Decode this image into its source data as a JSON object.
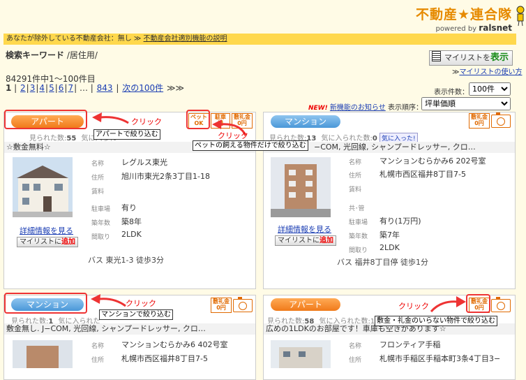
{
  "header": {
    "logo": "不動産★連合隊",
    "powered": "powered by",
    "brand": "ralsnet"
  },
  "exclusion": {
    "text": "あなたが除外している不動産会社：無し ≫",
    "link": "不動産会社適別機能の説明"
  },
  "search": {
    "label": "検索キーワード",
    "value": "/居住用/"
  },
  "mylist": {
    "button_prefix": "マイリストを",
    "button_action": "表示",
    "howto": "マイリストの使い方"
  },
  "results": {
    "count": "84291件中1〜100件目",
    "pages": [
      "2",
      "3",
      "4",
      "5",
      "6",
      "7"
    ],
    "current": "1",
    "ellipsis": "…",
    "last": "843",
    "next": "次の100件",
    "next_arrows": "≫≫"
  },
  "controls": {
    "display_count_label": "表示件数：",
    "display_count": "100件",
    "new_badge": "NEW!",
    "new_link": "新機能のお知らせ",
    "sort_label": "表示順序：",
    "sort_value": "坪単価順"
  },
  "common": {
    "seen_label": "見られた数:",
    "fav_label": "気に入られた数:",
    "fav_button": "気に入った!",
    "detail_link": "詳細情報を見る",
    "add_mylist_prefix": "マイリストに",
    "add_mylist_action": "追加",
    "pet_ok": "ペット\nOK",
    "no_key": "敷礼金\n0円",
    "label_name": "名称",
    "label_address": "住所",
    "label_rent": "賃料",
    "label_parking": "駐車場",
    "label_age": "築年数",
    "label_layout": "間取り",
    "label_fee": "共･管"
  },
  "cards": [
    {
      "type": "アパート",
      "seen": "55",
      "subtitle": "☆敷金無料☆",
      "name": "レグルス東光",
      "address": "旭川市東光2条3丁目1-18",
      "parking": "有り",
      "age": "築8年",
      "layout": "2LDK",
      "access": "バス 東光1-3 徒歩3分"
    },
    {
      "type": "マンション",
      "seen": "13",
      "fav": "0",
      "subtitle": "−COM, 光回線, シャンプードレッサー, クロ…",
      "name": "マンションむらかみ6 202号室",
      "address": "札幌市西区福井8丁目7-5",
      "parking": "有り(1万円)",
      "age": "築7年",
      "layout": "2LDK",
      "access": "バス 福井8丁目停 徒歩1分"
    },
    {
      "type": "マンション",
      "seen": "1",
      "fav_partial": "気に入られた",
      "subtitle": "敷金無し. J−COM, 光回線, シャンプードレッサー, クロ…",
      "name": "マンションむらかみ6 402号室",
      "address": "札幌市西区福井8丁目7-5"
    },
    {
      "type": "アパート",
      "seen": "58",
      "fav_partial": "気に入られた数:1",
      "subtitle": "広めの1LDKのお部屋です！車庫も空きがあります☆",
      "name": "フロンティア手稲",
      "address": "札幌市手稲区手稲本町3条4丁目3−"
    }
  ],
  "annotations": {
    "click": "クリック",
    "apartment_filter": "アパートで絞り込む",
    "pet_filter": "ペットの飼える物件だけで絞り込む",
    "mansion_filter": "マンションで絞り込む",
    "nokey_filter": "敷金・礼金のいらない物件で絞り込む"
  },
  "colors": {
    "orange_badge": "#f07a1a",
    "blue_badge": "#4a97d8",
    "annotation_red": "#e33333",
    "exclusion_bar": "#ffd84d"
  }
}
